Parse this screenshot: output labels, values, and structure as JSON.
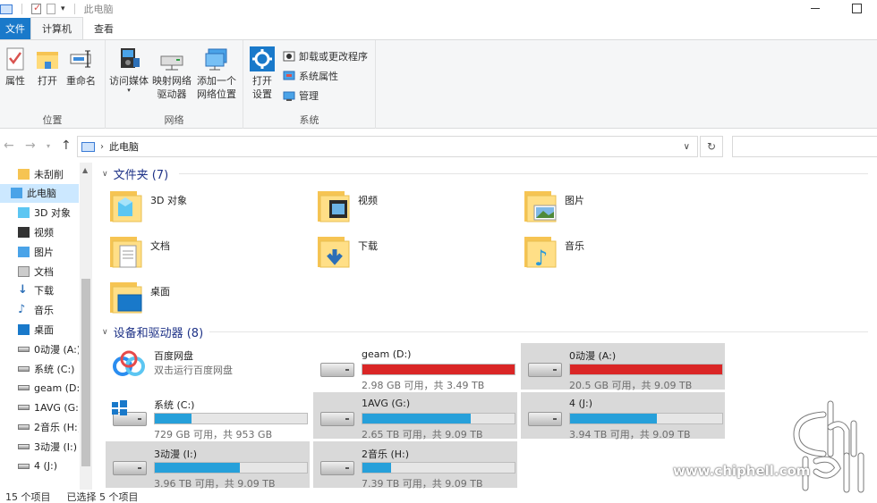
{
  "titlebar": {
    "title": "此电脑"
  },
  "ribbon_tabs": {
    "file": "文件",
    "computer": "计算机",
    "view": "查看"
  },
  "ribbon": {
    "location_group": {
      "label": "位置",
      "properties": "属性",
      "open": "打开",
      "rename": "重命名"
    },
    "network_group": {
      "label": "网络",
      "access_media": "访问媒体",
      "map_drive_line1": "映射网络",
      "map_drive_line2": "驱动器",
      "add_location_line1": "添加一个",
      "add_location_line2": "网络位置"
    },
    "system_group": {
      "label": "系统",
      "open_settings_line1": "打开",
      "open_settings_line2": "设置",
      "uninstall": "卸载或更改程序",
      "system_properties": "系统属性",
      "manage": "管理"
    }
  },
  "address": {
    "location": "此电脑"
  },
  "sidebar": {
    "items": [
      {
        "label": "未刮削",
        "icon": "folder-icon"
      },
      {
        "label": "此电脑",
        "icon": "pc-icon",
        "selected": true
      },
      {
        "label": "3D 对象",
        "icon": "3d-objects-icon"
      },
      {
        "label": "视频",
        "icon": "video-icon"
      },
      {
        "label": "图片",
        "icon": "pictures-icon"
      },
      {
        "label": "文档",
        "icon": "documents-icon"
      },
      {
        "label": "下载",
        "icon": "download-icon"
      },
      {
        "label": "音乐",
        "icon": "music-icon"
      },
      {
        "label": "桌面",
        "icon": "desktop-icon"
      },
      {
        "label": "0动漫 (A:)",
        "icon": "drive-icon"
      },
      {
        "label": "系统 (C:)",
        "icon": "drive-icon"
      },
      {
        "label": "geam (D:",
        "icon": "drive-icon"
      },
      {
        "label": "1AVG (G:)",
        "icon": "drive-icon"
      },
      {
        "label": "2音乐 (H:)",
        "icon": "drive-icon"
      },
      {
        "label": "3动漫 (I:)",
        "icon": "drive-icon"
      },
      {
        "label": "4 (J:)",
        "icon": "drive-icon"
      }
    ]
  },
  "folders_section": {
    "title": "文件夹 (7)",
    "items": [
      "3D 对象",
      "视频",
      "图片",
      "文档",
      "下载",
      "音乐",
      "桌面"
    ]
  },
  "drives_section": {
    "title": "设备和驱动器 (8)",
    "baidu": {
      "name": "百度网盘",
      "desc": "双击运行百度网盘"
    },
    "drives": [
      {
        "name": "geam (D:)",
        "info": "2.98 GB 可用，共 3.49 TB",
        "used_fraction": 0.999,
        "critical": true,
        "selected": false
      },
      {
        "name": "0动漫 (A:)",
        "info": "20.5 GB 可用，共 9.09 TB",
        "used_fraction": 0.998,
        "critical": true,
        "selected": true
      },
      {
        "name": "系统 (C:)",
        "info": "729 GB 可用，共 953 GB",
        "used_fraction": 0.24,
        "critical": false,
        "selected": false
      },
      {
        "name": "1AVG (G:)",
        "info": "2.65 TB 可用，共 9.09 TB",
        "used_fraction": 0.71,
        "critical": false,
        "selected": true
      },
      {
        "name": "4 (J:)",
        "info": "3.94 TB 可用，共 9.09 TB",
        "used_fraction": 0.57,
        "critical": false,
        "selected": true
      },
      {
        "name": "3动漫 (I:)",
        "info": "3.96 TB 可用，共 9.09 TB",
        "used_fraction": 0.56,
        "critical": false,
        "selected": true
      },
      {
        "name": "2音乐 (H:)",
        "info": "7.39 TB 可用，共 9.09 TB",
        "used_fraction": 0.19,
        "critical": false,
        "selected": true
      }
    ]
  },
  "statusbar": {
    "count": "15 个项目",
    "selected": "已选择 5 个项目"
  },
  "watermark": {
    "url": "www.chiphell.com",
    "logo_text": "chip hell"
  },
  "colors": {
    "accent": "#1979ca",
    "bar_normal": "#26a0da",
    "bar_critical": "#da2626",
    "selection": "#cce8ff",
    "folder_title": "#1e3287"
  }
}
